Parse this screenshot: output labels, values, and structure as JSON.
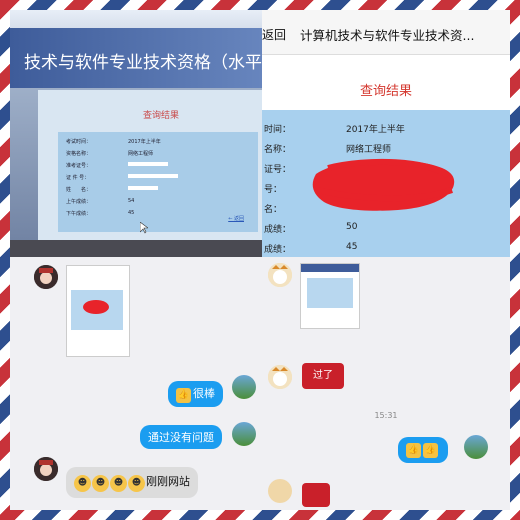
{
  "top_left": {
    "banner_text": "技术与软件专业技术资格（水平）",
    "result_title": "查询结果",
    "rows": [
      {
        "label": "考试时间：",
        "value": "2017年上半年"
      },
      {
        "label": "资格名称：",
        "value": "网络工程师"
      },
      {
        "label": "准考证号：",
        "value": ""
      },
      {
        "label": "证 件 号：",
        "value": ""
      },
      {
        "label": "姓　　名：",
        "value": ""
      },
      {
        "label": "上午成绩：",
        "value": "54"
      },
      {
        "label": "下午成绩：",
        "value": "45"
      }
    ],
    "back_link": "← 返回"
  },
  "top_right": {
    "back": "返回",
    "page_title": "计算机技术与软件专业技术资...",
    "result_title": "查询结果",
    "rows": [
      {
        "label": "时间：",
        "value": "2017年上半年"
      },
      {
        "label": "名称：",
        "value": "网络工程师"
      },
      {
        "label": "证号：",
        "value": ""
      },
      {
        "label": "号：",
        "value": ""
      },
      {
        "label": "名：",
        "value": ""
      },
      {
        "label": "成绩：",
        "value": "50"
      },
      {
        "label": "成绩：",
        "value": "45"
      }
    ],
    "redaction_color": "#e8232a"
  },
  "bottom_left": {
    "msg_1": "很棒",
    "msg_2": "通过没有问题",
    "msg_3": "刚刚网站"
  },
  "bottom_right": {
    "sticker_text": "过了",
    "time": "15:31"
  },
  "colors": {
    "bubble": "#1b9df0",
    "red": "#c8323a",
    "blue": "#2e4f8f"
  }
}
